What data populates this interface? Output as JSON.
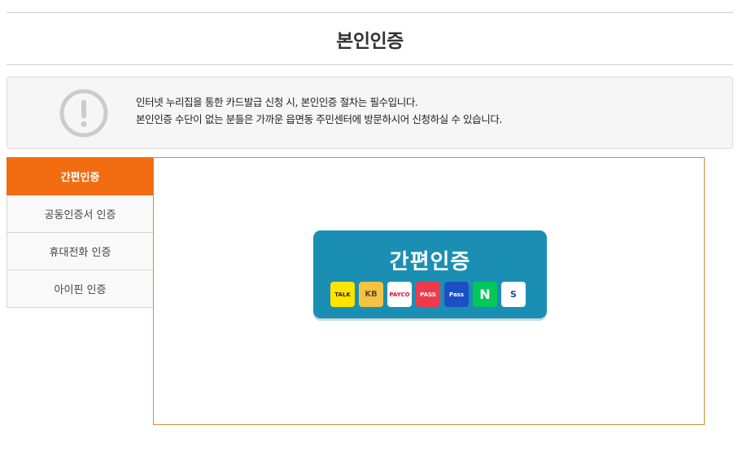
{
  "header": {
    "title": "본인인증"
  },
  "notice": {
    "icon": "exclamation-circle-icon",
    "lines": [
      "인터넷 누리집을 통한 카드발급 신청 시, 본인인증 절차는 필수입니다.",
      "본인인증 수단이 없는 분들은 가까운 읍면동 주민센터에 방문하시어 신청하실 수 있습니다."
    ]
  },
  "tabs": [
    {
      "label": "간편인증",
      "active": true
    },
    {
      "label": "공동인증서 인증",
      "active": false
    },
    {
      "label": "휴대전화 인증",
      "active": false
    },
    {
      "label": "아이핀 인증",
      "active": false
    }
  ],
  "easy_auth": {
    "label": "간편인증",
    "providers": [
      {
        "name": "kakaotalk-icon",
        "text": "TALK",
        "bg": "#fee500",
        "fg": "#3c1e1e"
      },
      {
        "name": "kb-icon",
        "text": "KB",
        "bg": "#f5c242",
        "fg": "#5a4a2a"
      },
      {
        "name": "payco-icon",
        "text": "PAYCO",
        "bg": "#ffffff",
        "fg": "#e4112c"
      },
      {
        "name": "pass-icon",
        "text": "PASS",
        "bg": "#ef3a4d",
        "fg": "#ffffff"
      },
      {
        "name": "samsung-pass-icon",
        "text": "Pass",
        "bg": "#1d4fc4",
        "fg": "#ffffff"
      },
      {
        "name": "naver-icon",
        "text": "N",
        "bg": "#03c75a",
        "fg": "#ffffff"
      },
      {
        "name": "shinhan-icon",
        "text": "S",
        "bg": "#ffffff",
        "fg": "#0a4fa3"
      }
    ]
  },
  "colors": {
    "accent": "#f26c12",
    "button": "#1b8fb3",
    "frame": "#d98a3d"
  }
}
